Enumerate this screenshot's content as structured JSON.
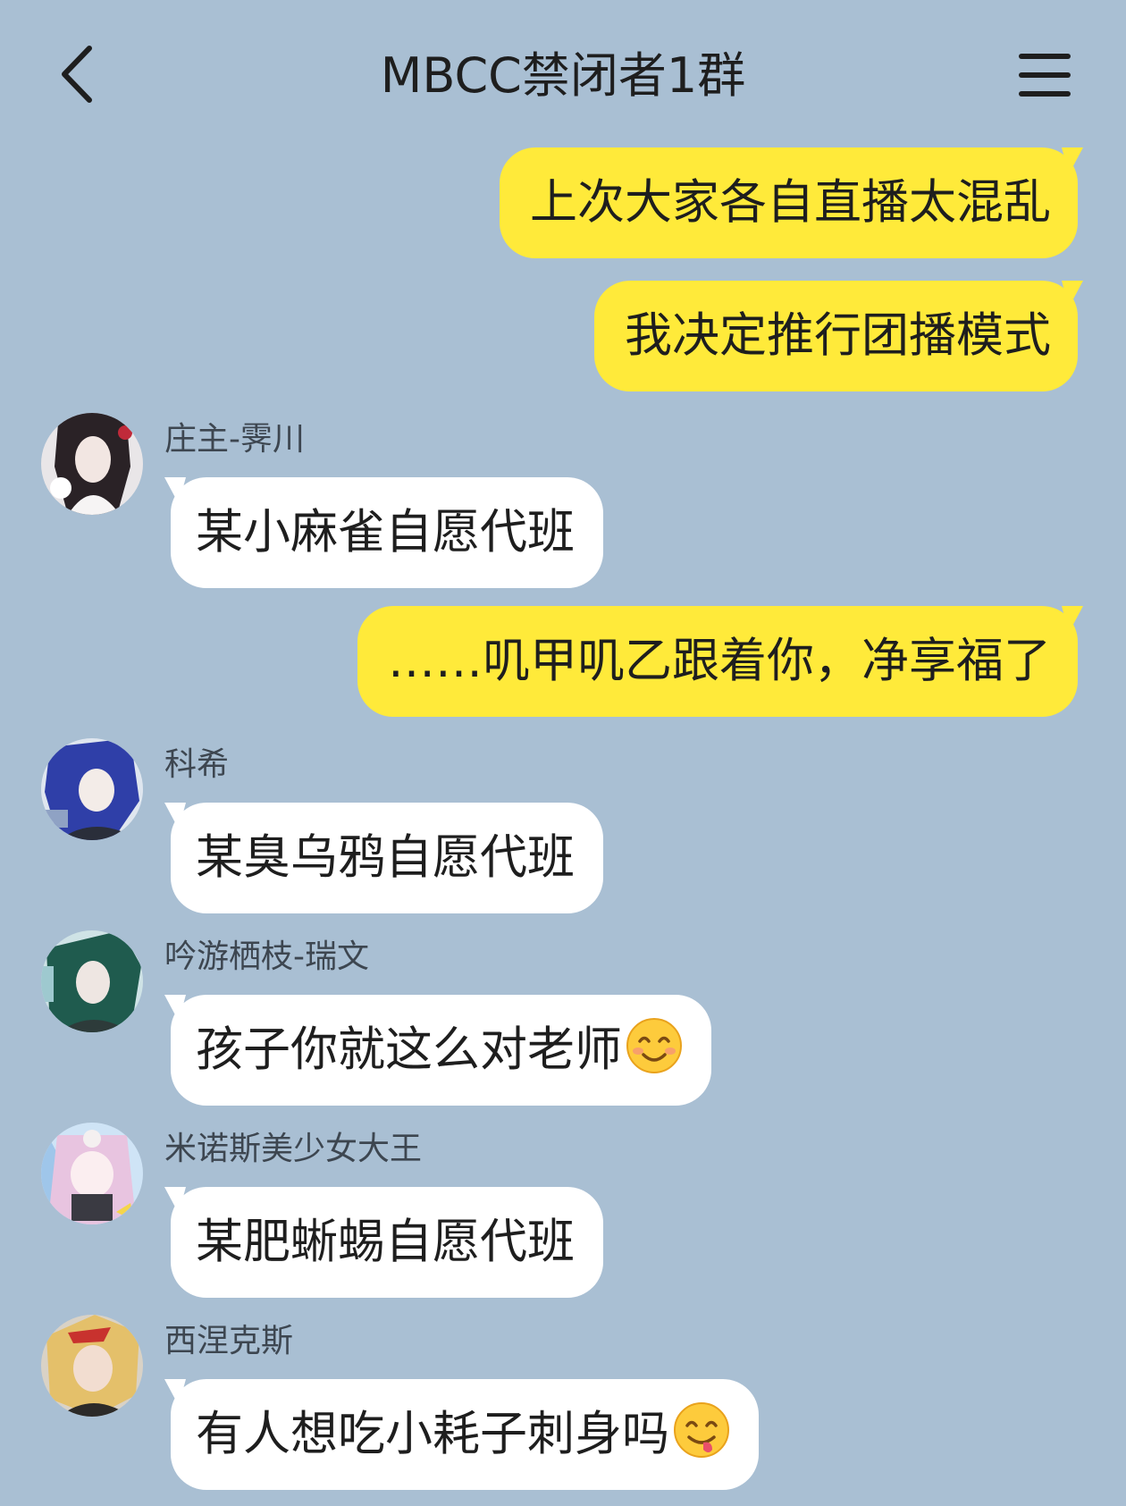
{
  "header": {
    "title": "MBCC禁闭者1群",
    "back_icon": "chevron-left-icon",
    "menu_icon": "hamburger-menu-icon"
  },
  "colors": {
    "background": "#a9bfd3",
    "outgoing_bubble": "#ffea3a",
    "incoming_bubble": "#ffffff"
  },
  "messages": [
    {
      "direction": "out",
      "text": "上次大家各自直播太混乱"
    },
    {
      "direction": "out",
      "text": "我决定推行团播模式"
    },
    {
      "direction": "in",
      "sender": "庄主-霁川",
      "text": "某小麻雀自愿代班"
    },
    {
      "direction": "out",
      "text": "……叽甲叽乙跟着你，净享福了"
    },
    {
      "direction": "in",
      "sender": "科希",
      "text": "某臭乌鸦自愿代班"
    },
    {
      "direction": "in",
      "sender": "吟游栖枝-瑞文",
      "text": "孩子你就这么对老师",
      "emoji": "smiling-face-icon"
    },
    {
      "direction": "in",
      "sender": "米诺斯美少女大王",
      "text": "某肥蜥蜴自愿代班"
    },
    {
      "direction": "in",
      "sender": "西涅克斯",
      "text": "有人想吃小耗子刺身吗",
      "emoji": "yummy-face-icon"
    }
  ]
}
